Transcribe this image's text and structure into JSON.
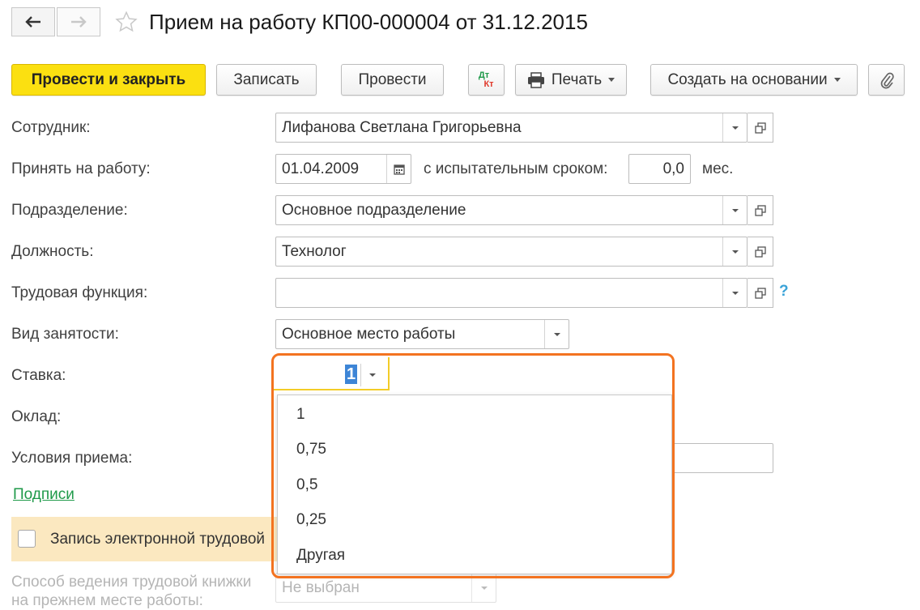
{
  "header": {
    "title": "Прием на работу КП00-000004 от 31.12.2015",
    "back_icon": "arrow-left-icon",
    "forward_icon": "arrow-right-icon",
    "favorite_icon": "star-icon"
  },
  "toolbar": {
    "post_close": "Провести и закрыть",
    "save": "Записать",
    "post": "Провести",
    "dtkt_top": "Дт",
    "dtkt_bottom": "Кт",
    "print": "Печать",
    "create_based": "Создать на основании"
  },
  "form": {
    "employee_label": "Сотрудник:",
    "employee_value": "Лифанова Светлана Григорьевна",
    "hire_date_label": "Принять на работу:",
    "hire_date_value": "01.04.2009",
    "probation_label": "с испытательным сроком:",
    "probation_value": "0,0",
    "probation_unit": "мес.",
    "department_label": "Подразделение:",
    "department_value": "Основное подразделение",
    "position_label": "Должность:",
    "position_value": "Технолог",
    "labor_function_label": "Трудовая функция:",
    "labor_function_value": "",
    "help_mark": "?",
    "employment_type_label": "Вид занятости:",
    "employment_type_value": "Основное место работы",
    "rate_label": "Ставка:",
    "rate_value": "1",
    "salary_label": "Оклад:",
    "conditions_label": "Условия приема:",
    "signatures_link": "Подписи",
    "electronic_record_label": "Запись электронной трудовой",
    "workbook_label_line1": "Способ ведения трудовой книжки",
    "workbook_label_line2": "на прежнем месте работы:",
    "workbook_value": "Не выбран"
  },
  "rate_dropdown": {
    "options": [
      "1",
      "0,75",
      "0,5",
      "0,25",
      "Другая"
    ]
  },
  "colors": {
    "primary_button": "#fbe011",
    "highlight_outline": "#f37320",
    "link": "#1f9a4a",
    "selection": "#3d85d6",
    "info_bar": "#fbe8c0"
  }
}
